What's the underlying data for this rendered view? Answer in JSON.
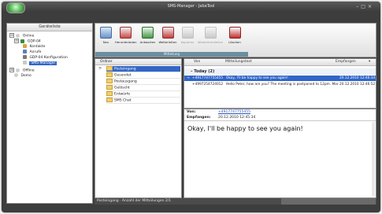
{
  "window": {
    "title": "SMS-Manager - JabaTool"
  },
  "sidebar": {
    "header": "Geräteliste",
    "items": [
      {
        "label": "Online",
        "expanded": "⊟"
      },
      {
        "label": "GDP-04",
        "expanded": "⊟"
      },
      {
        "label": "Kontakte"
      },
      {
        "label": "Anrufe"
      },
      {
        "label": "GDP-04 Konfiguration"
      },
      {
        "label": "SMS-Manager"
      },
      {
        "label": "Offline",
        "expanded": "⊞"
      },
      {
        "label": "Demo"
      }
    ]
  },
  "ribbon": {
    "buttons": [
      {
        "label": "Neu"
      },
      {
        "label": "Herunterladen"
      },
      {
        "label": "Antworten"
      },
      {
        "label": "Weiterleiten"
      },
      {
        "label": "Kopieren"
      },
      {
        "label": "Wiederherstellen"
      },
      {
        "label": "Löschen"
      }
    ],
    "group_label": "Mitteilung"
  },
  "folders": {
    "header": "Ordner",
    "items": [
      {
        "label": "Posteingang"
      },
      {
        "label": "Gesendet"
      },
      {
        "label": "Postausgang"
      },
      {
        "label": "Gelöscht"
      },
      {
        "label": "Entwürfe"
      },
      {
        "label": "SMS Chat"
      }
    ]
  },
  "messages": {
    "columns": {
      "from": "Von",
      "text": "Mitteilungstext",
      "received": "Empfangen"
    },
    "group": "Today (2)",
    "rows": [
      {
        "from": "+4917747755455",
        "text": "Okay, I'll be happy to see you again!",
        "date": "20.12.2010 12:46:34"
      },
      {
        "from": "+4997254724012",
        "text": "Hello Peter, how are you? The meeting is postponed to 12pm. Maria",
        "date": "20.12.2010 12:46:52"
      }
    ]
  },
  "detail": {
    "from_label": "Von:",
    "from_value": "+4917747755455",
    "received_label": "Empfangen:",
    "received_value": "20.12.2010 12:45:34",
    "body": "Okay, I'll be happy to see you again!"
  },
  "status": {
    "text": "Posteingang · Anzahl der Mitteilungen 2/1"
  }
}
